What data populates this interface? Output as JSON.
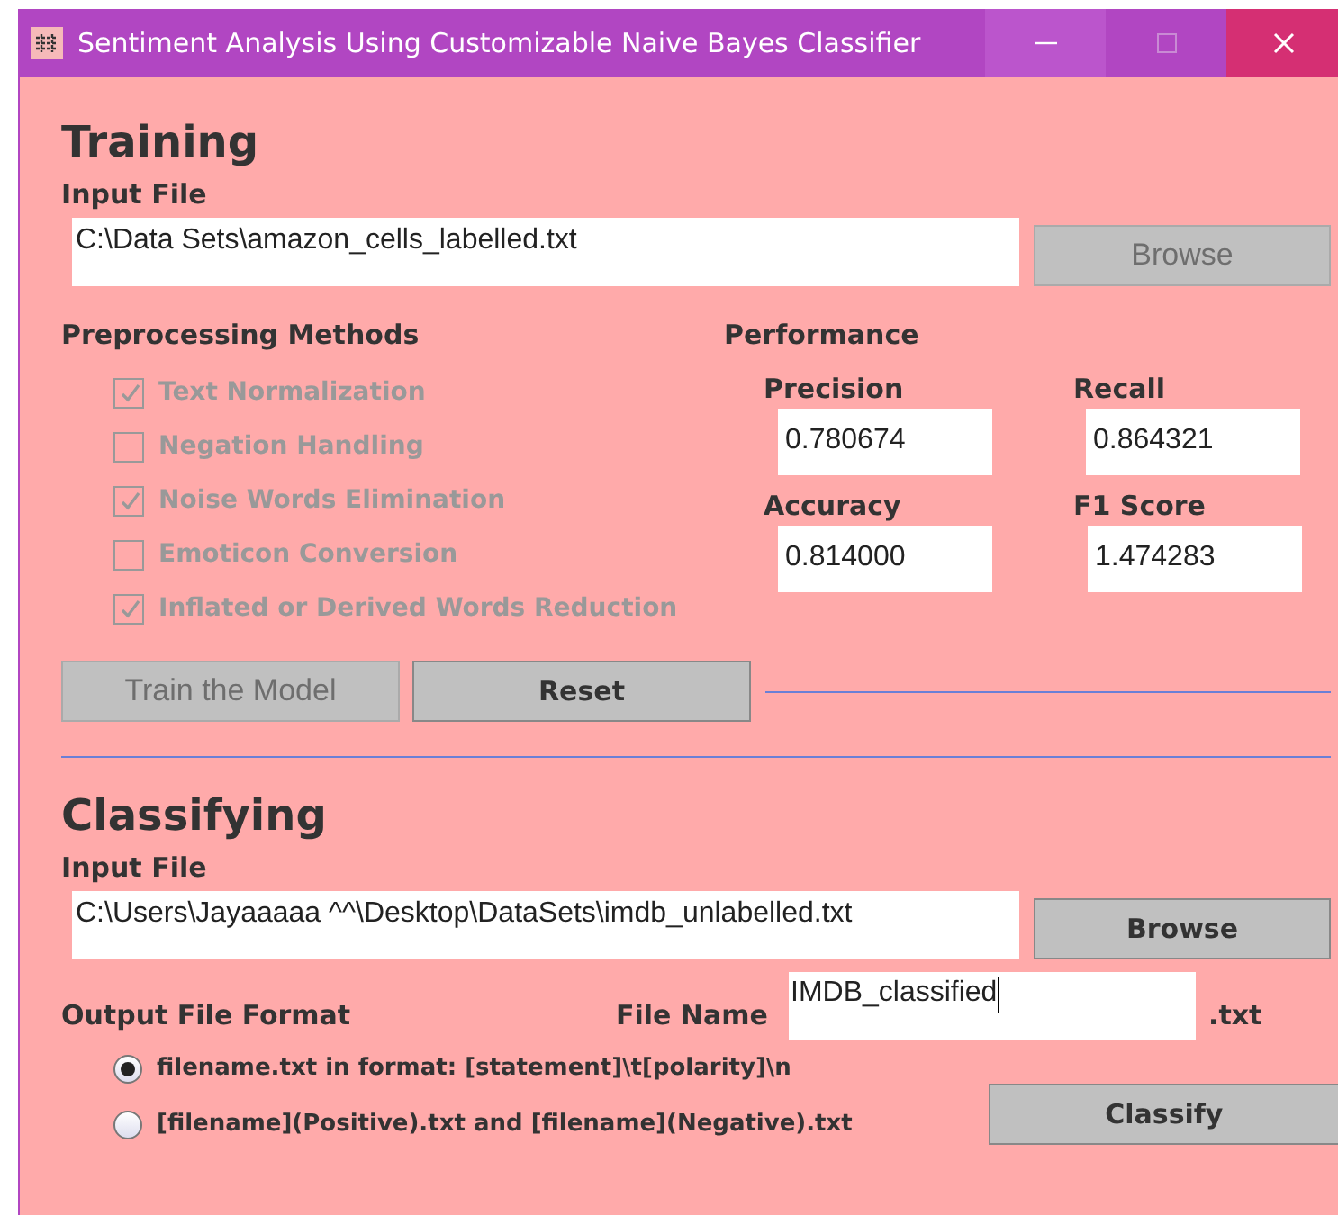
{
  "window": {
    "title": "Sentiment Analysis Using Customizable Naive Bayes Classifier"
  },
  "training": {
    "heading": "Training",
    "input_label": "Input File",
    "input_value": "C:\\Data Sets\\amazon_cells_labelled.txt",
    "browse": {
      "label": "Browse",
      "disabled": true
    },
    "preprocessing": {
      "heading": "Preprocessing Methods",
      "options": [
        {
          "label": "Text Normalization",
          "checked": true,
          "disabled": true
        },
        {
          "label": "Negation Handling",
          "checked": false,
          "disabled": true
        },
        {
          "label": "Noise Words Elimination",
          "checked": true,
          "disabled": true
        },
        {
          "label": "Emoticon Conversion",
          "checked": false,
          "disabled": true
        },
        {
          "label": "Inflated or Derived Words Reduction",
          "checked": true,
          "disabled": true
        }
      ]
    },
    "performance": {
      "heading": "Performance",
      "metrics": [
        {
          "label": "Precision",
          "value": "0.780674"
        },
        {
          "label": "Recall",
          "value": "0.864321"
        },
        {
          "label": "Accuracy",
          "value": "0.814000"
        },
        {
          "label": "F1 Score",
          "value": "1.474283"
        }
      ]
    },
    "buttons": [
      {
        "label": "Train the Model",
        "disabled": true
      },
      {
        "label": "Reset",
        "disabled": false
      }
    ]
  },
  "classifying": {
    "heading": "Classifying",
    "input_label": "Input File",
    "input_value": "C:\\Users\\Jayaaaaa ^^\\Desktop\\DataSets\\imdb_unlabelled.txt",
    "browse": {
      "label": "Browse",
      "disabled": false
    },
    "output_format": {
      "label": "Output File Format",
      "options": [
        {
          "label": "filename.txt in format: [statement]\\t[polarity]\\n",
          "selected": true
        },
        {
          "label": "[filename](Positive).txt and [filename](Negative).txt",
          "selected": false
        }
      ]
    },
    "file_name": {
      "label": "File Name",
      "value": "IMDB_classified",
      "suffix": ".txt"
    },
    "classify": {
      "label": "Classify",
      "disabled": false
    }
  }
}
